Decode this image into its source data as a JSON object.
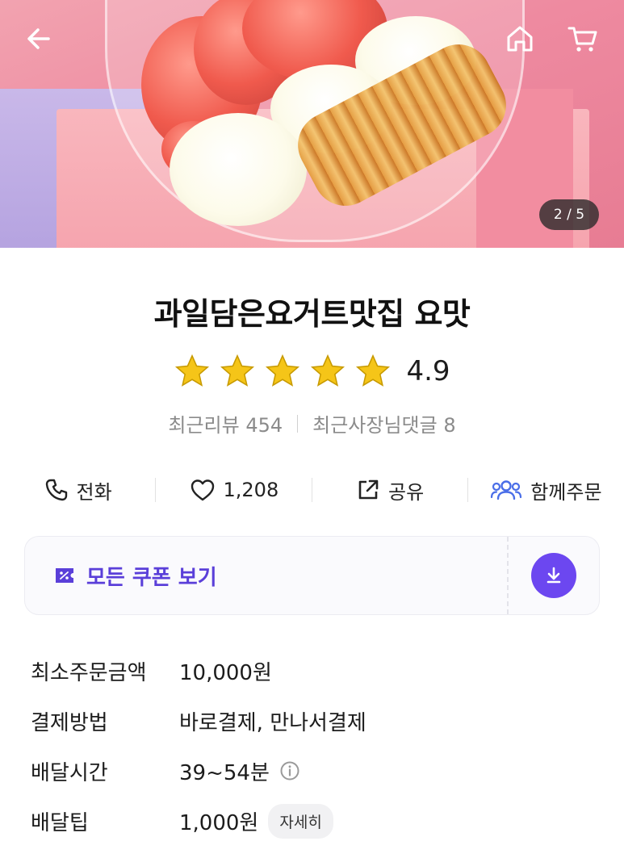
{
  "hero": {
    "pager": "2 / 5"
  },
  "nav": {
    "back_icon": "arrow-left-icon",
    "home_icon": "home-icon",
    "cart_icon": "cart-icon"
  },
  "store": {
    "name": "과일담은요거트맛집 요맛",
    "rating": "4.9",
    "stars": 5,
    "recent_reviews": "최근리뷰 454",
    "owner_replies": "최근사장님댓글 8"
  },
  "actions": [
    {
      "label": "전화",
      "icon": "phone-icon"
    },
    {
      "label": "1,208",
      "icon": "heart-icon"
    },
    {
      "label": "공유",
      "icon": "share-icon"
    },
    {
      "label": "함께주문",
      "icon": "group-icon"
    }
  ],
  "coupon": {
    "label": "모든 쿠폰 보기",
    "icon": "coupon-icon",
    "download_icon": "download-icon"
  },
  "details": {
    "min_order_label": "최소주문금액",
    "min_order_value": "10,000원",
    "payment_label": "결제방법",
    "payment_value": "바로결제, 만나서결제",
    "delivery_time_label": "배달시간",
    "delivery_time_value": "39~54분",
    "delivery_tip_label": "배달팁",
    "delivery_tip_value": "1,000원",
    "delivery_tip_detail": "자세히"
  },
  "colors": {
    "accent": "#6c47f0",
    "coupon_text": "#5a3fd9",
    "star": "#f5c518"
  }
}
